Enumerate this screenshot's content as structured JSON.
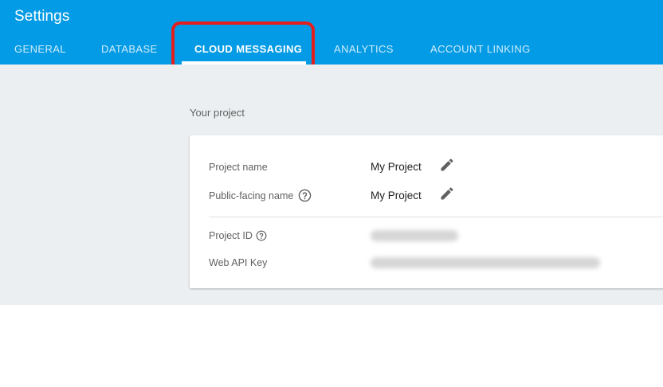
{
  "header": {
    "title": "Settings",
    "tabs": [
      {
        "label": "GENERAL"
      },
      {
        "label": "DATABASE"
      },
      {
        "label": "CLOUD MESSAGING"
      },
      {
        "label": "ANALYTICS"
      },
      {
        "label": "ACCOUNT LINKING"
      }
    ],
    "active_tab": "CLOUD MESSAGING"
  },
  "main": {
    "section_label": "Your project",
    "fields": [
      {
        "label": "Project name",
        "value": "My Project"
      },
      {
        "label": "Public-facing name",
        "value": "My Project"
      },
      {
        "label": "Project ID",
        "value": ""
      },
      {
        "label": "Web API Key",
        "value": ""
      }
    ]
  },
  "icons": {
    "edit": "pencil-icon",
    "help": "help-circle-icon"
  },
  "colors": {
    "header_bg": "#039be5",
    "page_bg": "#eceff1",
    "highlight_border": "#e41e1e",
    "card_bg": "#ffffff"
  }
}
